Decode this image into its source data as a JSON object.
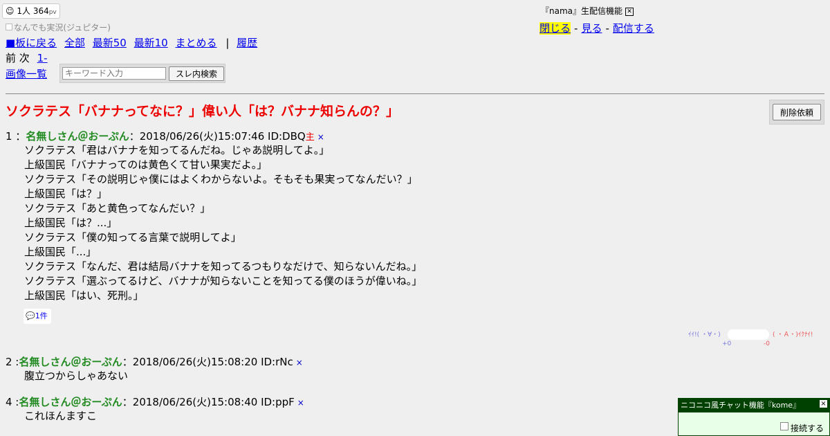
{
  "header": {
    "viewers": "1人",
    "pageviews": "364",
    "pv_unit": "pv",
    "board_title": "なんでも実況(ジュピター)"
  },
  "nav": {
    "back": "■板に戻る",
    "all": "全部",
    "latest50": "最新50",
    "latest10": "最新10",
    "summarize": "まとめる",
    "separator": "|",
    "history": "履歴"
  },
  "pager": {
    "prev": "前",
    "next": "次",
    "range": "1-"
  },
  "imglist": "画像一覧",
  "search": {
    "placeholder": "キーワード入力",
    "button": "スレ内検索"
  },
  "nama": {
    "label": "『nama』生配信機能",
    "close": "閉じる",
    "watch": "見る",
    "broadcast": "配信する",
    "dash": "-"
  },
  "thread": {
    "title": "ソクラテス「バナナってなに？」偉い人「は？バナナ知らんの？」",
    "delete_request": "削除依頼"
  },
  "posts": [
    {
      "num": "1 ：",
      "name": "名無しさん＠おーぷん",
      "meta": "：2018/06/26(火)15:07:46 ID:DBQ",
      "owner": "主",
      "x": "×",
      "lines": [
        "ソクラテス「君はバナナを知ってるんだね。じゃあ説明してよ。」",
        "上級国民「バナナってのは黄色くて甘い果実だよ。」",
        "ソクラテス「その説明じゃ僕にはよくわからないよ。そもそも果実ってなんだい？」",
        "上級国民「は？」",
        "ソクラテス「あと黄色ってなんだい？」",
        "上級国民「は？...」",
        "ソクラテス「僕の知ってる言葉で説明してよ」",
        "上級国民「...」",
        "ソクラテス「なんだ、君は結局バナナを知ってるつもりなだけで、知らないんだね。」",
        "ソクラテス「選ぶってるけど、バナナが知らないことを知ってる僕のほうが偉いね。」",
        "上級国民「はい、死刑。」"
      ],
      "replies": "1件"
    },
    {
      "num": "2 :",
      "name": "名無しさん＠おーぷん",
      "meta": "：2018/06/26(火)15:08:20 ID:rNc",
      "x": "×",
      "lines": [
        "腹立つからしゃあない"
      ]
    },
    {
      "num": "4 :",
      "name": "名無しさん＠おーぷん",
      "meta": "：2018/06/26(火)15:08:40 ID:ppF",
      "x": "×",
      "lines": [
        "これほんますこ"
      ]
    }
  ],
  "vote": {
    "good_label": "ｲｲ!( ・∀・)",
    "bad_label": "( ・Ａ・)ｲｸﾅｲ!",
    "good_count": "+0",
    "bad_count": "-0"
  },
  "chat": {
    "title": "ニコニコ風チャット機能『kome』",
    "close": "×",
    "connect": "接続する"
  }
}
